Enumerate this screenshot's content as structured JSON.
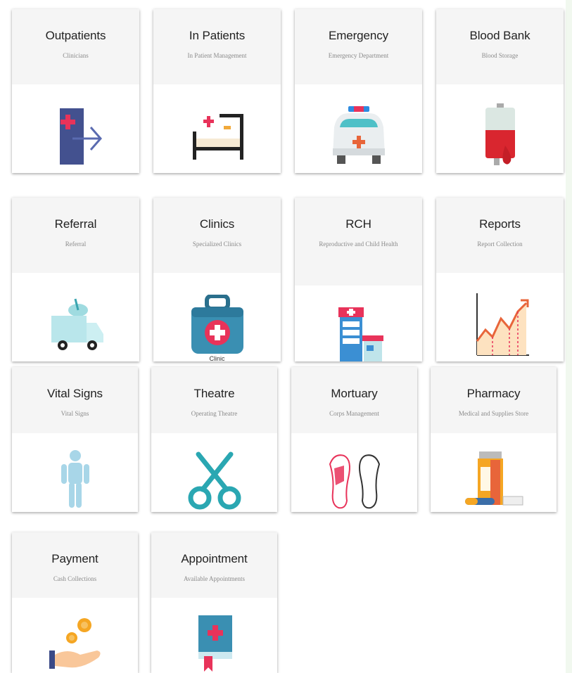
{
  "modules": [
    {
      "title": "Outpatients",
      "subtitle": "Clinicians",
      "icon": "door-exit-icon"
    },
    {
      "title": "In Patients",
      "subtitle": "In Patient Management",
      "icon": "hospital-bed-icon"
    },
    {
      "title": "Emergency",
      "subtitle": "Emergency Department",
      "icon": "ambulance-icon"
    },
    {
      "title": "Blood Bank",
      "subtitle": "Blood Storage",
      "icon": "blood-bag-icon"
    },
    {
      "title": "Referral",
      "subtitle": "Referral",
      "icon": "referral-van-icon"
    },
    {
      "title": "Clinics",
      "subtitle": "Specialized Clinics",
      "icon": "medical-kit-icon",
      "link": "Clinic"
    },
    {
      "title": "RCH",
      "subtitle": "Reproductive and Child Health",
      "icon": "hospital-building-icon"
    },
    {
      "title": "Reports",
      "subtitle": "Report Collection",
      "icon": "rising-chart-icon"
    },
    {
      "title": "Vital Signs",
      "subtitle": "Vital Signs",
      "icon": "body-figure-icon"
    },
    {
      "title": "Theatre",
      "subtitle": "Operating Theatre",
      "icon": "surgical-scissors-icon"
    },
    {
      "title": "Mortuary",
      "subtitle": "Corps Management",
      "icon": "feet-icon"
    },
    {
      "title": "Pharmacy",
      "subtitle": "Medical and Supplies Store",
      "icon": "pill-bottle-icon"
    },
    {
      "title": "Payment",
      "subtitle": "Cash Collections",
      "icon": "coins-hand-icon"
    },
    {
      "title": "Appointment",
      "subtitle": "Available Appointments",
      "icon": "appointment-book-icon"
    }
  ]
}
